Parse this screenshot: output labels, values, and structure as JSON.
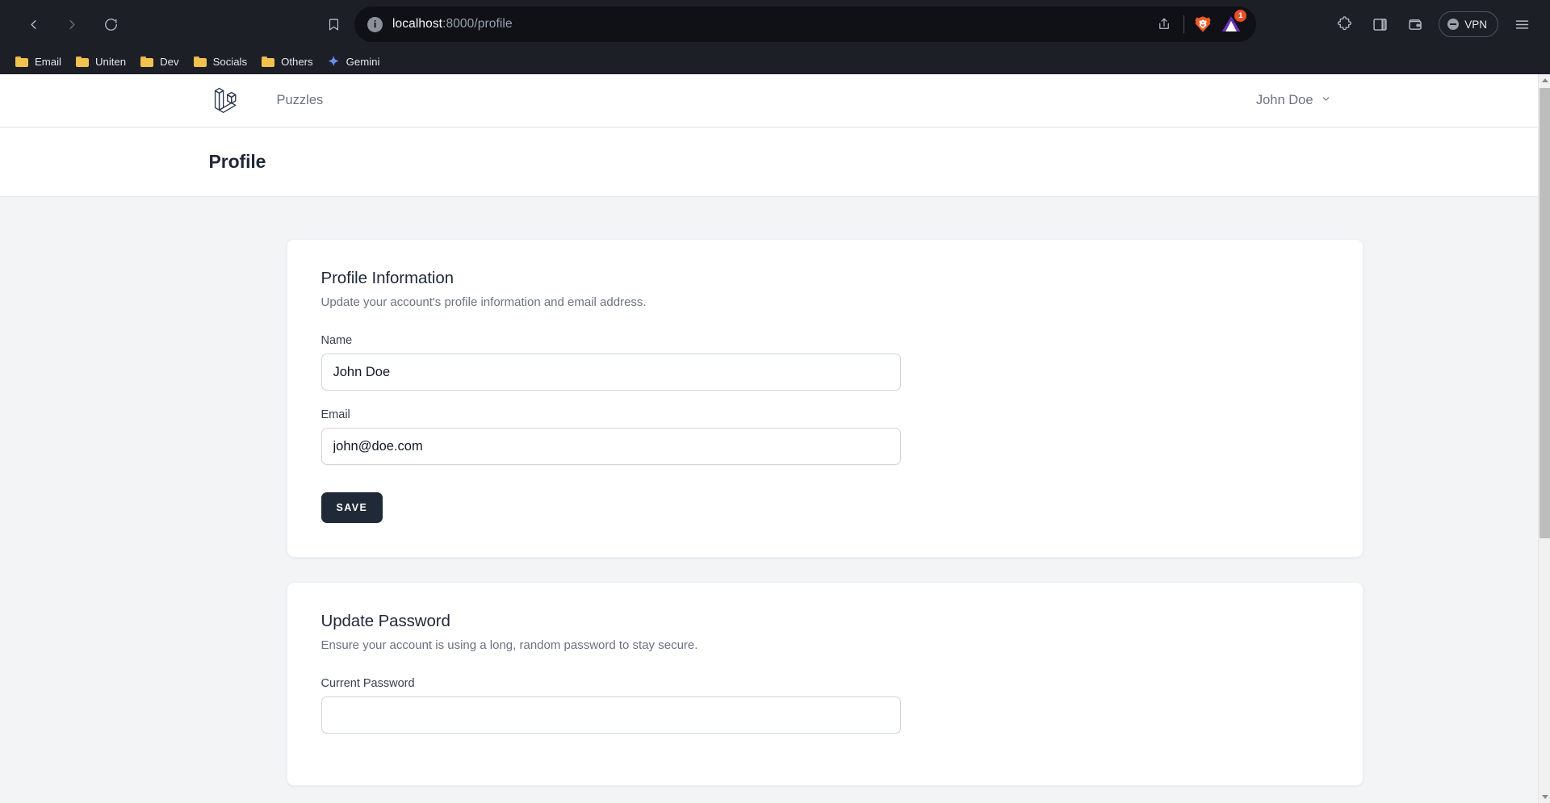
{
  "browser": {
    "back_icon": "chevron-left-icon",
    "forward_icon": "chevron-right-icon",
    "reload_icon": "reload-icon",
    "bookmark_icon": "bookmark-icon",
    "site_info_icon": "info-icon",
    "url_host": "localhost",
    "url_path": ":8000/profile",
    "share_icon": "share-icon",
    "shields_icon": "brave-shields-lion-icon",
    "extension_icon": "extension-triangle-icon",
    "extension_badge": "1",
    "extensions_icon": "puzzle-piece-icon",
    "sidebar_icon": "sidebar-panel-icon",
    "wallet_icon": "wallet-icon",
    "vpn_label": "VPN",
    "vpn_icon": "vpn-status-icon",
    "menu_icon": "hamburger-menu-icon",
    "bookmarks": [
      {
        "label": "Email",
        "icon": "folder-icon"
      },
      {
        "label": "Uniten",
        "icon": "folder-icon"
      },
      {
        "label": "Dev",
        "icon": "folder-icon"
      },
      {
        "label": "Socials",
        "icon": "folder-icon"
      },
      {
        "label": "Others",
        "icon": "folder-icon"
      },
      {
        "label": "Gemini",
        "icon": "gemini-sparkle-icon"
      }
    ]
  },
  "app": {
    "logo_icon": "laravel-logo-icon",
    "nav": {
      "puzzles_label": "Puzzles"
    },
    "user": {
      "name": "John Doe",
      "chevron_icon": "chevron-down-icon"
    },
    "page_title": "Profile"
  },
  "profile_information": {
    "title": "Profile Information",
    "subtitle": "Update your account's profile information and email address.",
    "name_label": "Name",
    "name_value": "John Doe",
    "name_placeholder": "",
    "email_label": "Email",
    "email_value": "john@doe.com",
    "email_placeholder": "",
    "save_label": "SAVE"
  },
  "update_password": {
    "title": "Update Password",
    "subtitle": "Ensure your account is using a long, random password to stay secure.",
    "current_password_label": "Current Password",
    "current_password_value": "",
    "current_password_placeholder": ""
  },
  "colors": {
    "chrome_bg": "#1c1f26",
    "urlbar_bg": "#0f1116",
    "page_bg": "#f3f4f6",
    "card_bg": "#ffffff",
    "accent_dark": "#1f2937",
    "badge_red": "#e8502b",
    "folder_yellow": "#f2c14e"
  },
  "scrollbar": {
    "up_icon": "scroll-up-arrow-icon",
    "down_icon": "scroll-down-arrow-icon"
  }
}
